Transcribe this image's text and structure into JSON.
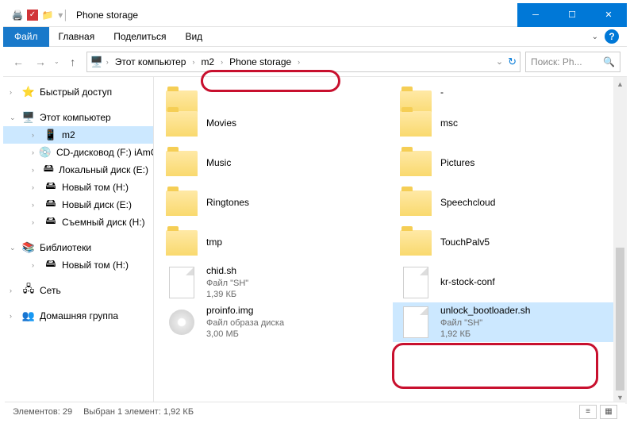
{
  "window": {
    "title": "Phone storage"
  },
  "ribbon": {
    "file": "Файл",
    "tabs": [
      "Главная",
      "Поделиться",
      "Вид"
    ]
  },
  "breadcrumb": {
    "root": "Этот компьютер",
    "part1": "m2",
    "part2": "Phone storage"
  },
  "search": {
    "placeholder": "Поиск: Ph..."
  },
  "sidebar": {
    "quick_access": "Быстрый доступ",
    "this_pc": "Этот компьютер",
    "m2": "m2",
    "cd": "CD-дисковод (F:) iAmC",
    "local_disk": "Локальный диск (E:)",
    "new_vol_h": "Новый том (H:)",
    "new_vol_e": "Новый диск (E:)",
    "removable": "Съемный диск (H:)",
    "libraries": "Библиотеки",
    "new_vol_h2": "Новый том (H:)",
    "network": "Сеть",
    "homegroup": "Домашняя группа"
  },
  "files": {
    "dash": "-",
    "movies": "Movies",
    "msc": "msc",
    "music": "Music",
    "pictures": "Pictures",
    "ringtones": "Ringtones",
    "speechcloud": "Speechcloud",
    "tmp": "tmp",
    "touchpalv5": "TouchPalv5",
    "chid_sh": {
      "name": "chid.sh",
      "type": "Файл \"SH\"",
      "size": "1,39 КБ"
    },
    "kr_stock": {
      "name": "kr-stock-conf"
    },
    "proinfo": {
      "name": "proinfo.img",
      "type": "Файл образа диска",
      "size": "3,00 МБ"
    },
    "unlock": {
      "name": "unlock_bootloader.sh",
      "type": "Файл \"SH\"",
      "size": "1,92 КБ"
    }
  },
  "status": {
    "count": "Элементов: 29",
    "selection": "Выбран 1 элемент: 1,92 КБ"
  }
}
